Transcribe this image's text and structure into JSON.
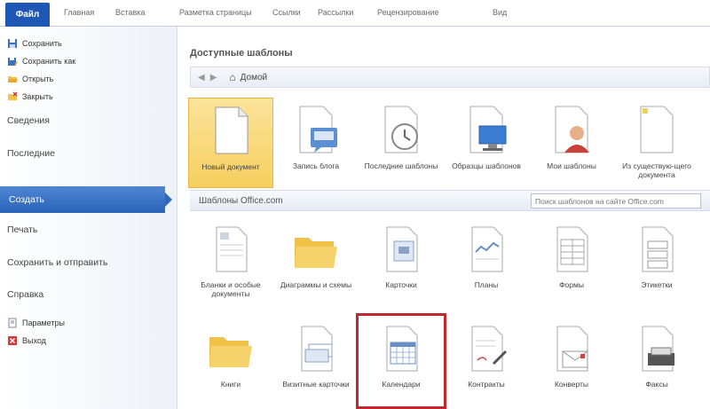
{
  "ribbon": {
    "file_tab": "Файл",
    "tabs": [
      "Главная",
      "Вставка",
      "Разметка страницы",
      "Ссылки",
      "Рассылки",
      "Рецензирование",
      "Вид"
    ]
  },
  "sidebar": {
    "save": "Сохранить",
    "save_as": "Сохранить как",
    "open": "Открыть",
    "close": "Закрыть",
    "info": "Сведения",
    "recent": "Последние",
    "new": "Создать",
    "print": "Печать",
    "save_send": "Сохранить и отправить",
    "help": "Справка",
    "options": "Параметры",
    "exit": "Выход"
  },
  "main": {
    "heading": "Доступные шаблоны",
    "nav": {
      "back": "◀",
      "forward": "▶",
      "home_label": "Домой"
    },
    "top_tiles": [
      {
        "label": "Новый документ",
        "icon": "blank-document-icon",
        "selected": true
      },
      {
        "label": "Запись блога",
        "icon": "blog-post-icon"
      },
      {
        "label": "Последние шаблоны",
        "icon": "recent-templates-icon"
      },
      {
        "label": "Образцы шаблонов",
        "icon": "sample-templates-icon"
      },
      {
        "label": "Мои шаблоны",
        "icon": "my-templates-icon"
      },
      {
        "label": "Из существую-щего документа",
        "icon": "from-existing-icon"
      }
    ],
    "office": {
      "title": "Шаблоны Office.com",
      "search_placeholder": "Поиск шаблонов на сайте Office.com"
    },
    "office_row1": [
      {
        "label": "Бланки и особые документы",
        "icon": "forms-document-icon"
      },
      {
        "label": "Диаграммы и схемы",
        "icon": "folder-icon"
      },
      {
        "label": "Карточки",
        "icon": "cards-icon"
      },
      {
        "label": "Планы",
        "icon": "plans-icon"
      },
      {
        "label": "Формы",
        "icon": "forms-icon"
      },
      {
        "label": "Этикетки",
        "icon": "labels-icon"
      }
    ],
    "office_row2": [
      {
        "label": "Книги",
        "icon": "folder-icon"
      },
      {
        "label": "Визитные карточки",
        "icon": "business-cards-icon"
      },
      {
        "label": "Календари",
        "icon": "calendar-icon",
        "highlighted": true
      },
      {
        "label": "Контракты",
        "icon": "contracts-icon"
      },
      {
        "label": "Конверты",
        "icon": "envelope-icon"
      },
      {
        "label": "Факсы",
        "icon": "fax-icon"
      }
    ]
  },
  "colors": {
    "accent": "#2a63b8",
    "selected_tile": "#f6cf5e",
    "highlight_border": "#c0282d"
  }
}
